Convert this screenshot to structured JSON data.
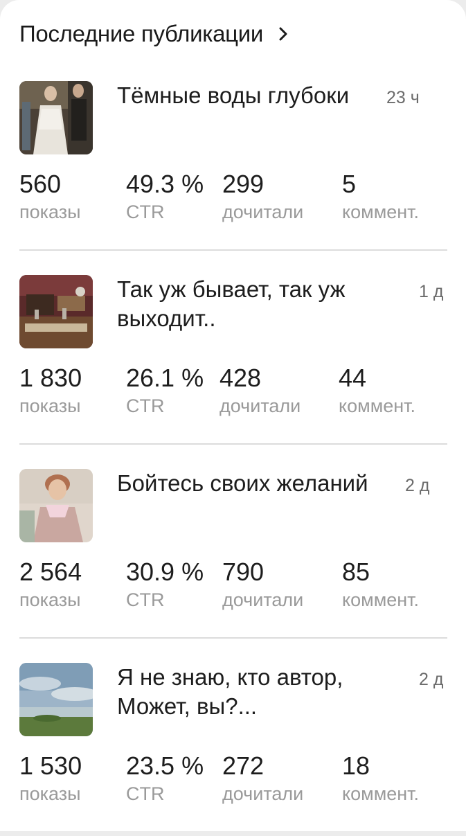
{
  "header": {
    "title": "Последние публикации"
  },
  "labels": {
    "views": "показы",
    "ctr": "CTR",
    "reads": "дочитали",
    "comments": "коммент."
  },
  "publications": [
    {
      "title": "Тёмные воды глубоки",
      "time": "23 ч",
      "views": "560",
      "ctr": "49.3 %",
      "reads": "299",
      "comments": "5"
    },
    {
      "title": "Так уж бывает, так уж выходит..",
      "time": "1 д",
      "views": "1 830",
      "ctr": "26.1 %",
      "reads": "428",
      "comments": "44"
    },
    {
      "title": "Бойтесь своих желаний",
      "time": "2 д",
      "views": "2 564",
      "ctr": "30.9 %",
      "reads": "790",
      "comments": "85"
    },
    {
      "title": "Я не знаю, кто автор, Может, вы?...",
      "time": "2 д",
      "views": "1 530",
      "ctr": "23.5 %",
      "reads": "272",
      "comments": "18"
    }
  ]
}
